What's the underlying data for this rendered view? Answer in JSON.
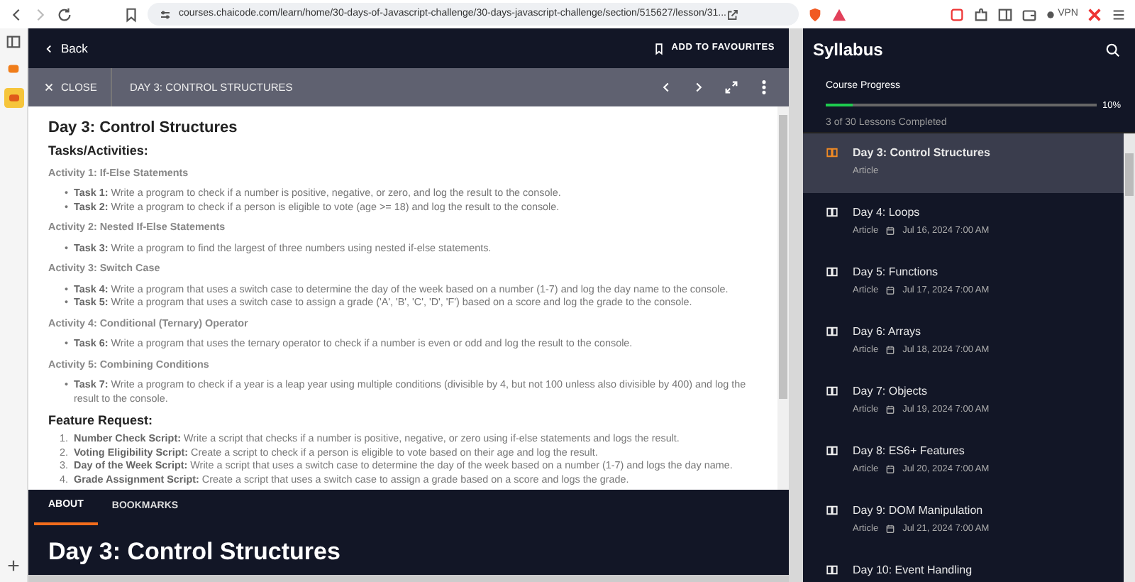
{
  "browser": {
    "url": "courses.chaicode.com/learn/home/30-days-of-Javascript-challenge/30-days-javascript-challenge/section/515627/lesson/31...",
    "vpn_label": "VPN"
  },
  "header": {
    "back_label": "Back",
    "favourite_label": "ADD TO FAVOURITES"
  },
  "lesson_bar": {
    "close_label": "CLOSE",
    "title": "DAY 3: CONTROL STRUCTURES"
  },
  "article": {
    "title": "Day 3: Control Structures",
    "tasks_heading": "Tasks/Activities:",
    "activities": [
      {
        "heading": "Activity 1: If-Else Statements",
        "marker": "•",
        "tasks": [
          "**Task 1:** Write a program to check if a number is positive, negative, or zero, and log the result to the console.",
          "**Task 2:** Write a program to check if a person is eligible to vote (age >= 18) and log the result to the console."
        ]
      },
      {
        "heading": "Activity 2: Nested If-Else Statements",
        "tasks": [
          "**Task 3:** Write a program to find the largest of three numbers using nested if-else statements."
        ]
      },
      {
        "heading": "Activity 3: Switch Case",
        "tasks": [
          "**Task 4:** Write a program that uses a switch case to determine the day of the week based on a number (1-7) and log the day name to the console.",
          "**Task 5:** Write a program that uses a switch case to assign a grade ('A', 'B', 'C', 'D', 'F') based on a score and log the grade to the console."
        ]
      },
      {
        "heading": "Activity 4: Conditional (Ternary) Operator",
        "tasks": [
          "**Task 6:** Write a program that uses the ternary operator to check if a number is even or odd and log the result to the console."
        ]
      },
      {
        "heading": "Activity 5: Combining Conditions",
        "tasks": [
          "**Task 7:** Write a program to check if a year is a leap year using multiple conditions (divisible by 4, but not 100 unless also divisible by 400) and log the result to the console."
        ]
      }
    ],
    "feature_heading": "Feature Request:",
    "feature_markers": [
      "1.",
      "2.",
      "3.",
      "4."
    ],
    "features": [
      "**Number Check Script:** Write a script that checks if a number is positive, negative, or zero using if-else statements and logs the result.",
      "**Voting Eligibility Script:** Create a script to check if a person is eligible to vote based on their age and log the result.",
      "**Day of the Week Script:** Write a script that uses a switch case to determine the day of the week based on a number (1-7) and logs the day name.",
      "**Grade Assignment Script:** Create a script that uses a switch case to assign a grade based on a score and logs the grade."
    ]
  },
  "tabs": [
    {
      "label": "ABOUT",
      "selected": true
    },
    {
      "label": "BOOKMARKS",
      "selected": false
    }
  ],
  "about_title": "Day 3: Control Structures",
  "syllabus": {
    "title": "Syllabus",
    "progress_label": "Course Progress",
    "level": 0.1,
    "percent": "10%",
    "completed": "3 of 30 Lessons Completed",
    "lessons": [
      {
        "title": "Day 3: Control Structures",
        "type": "Article",
        "selected": true
      },
      {
        "title": "Day 4: Loops",
        "type": "Article",
        "date": "Jul 16, 2024 7:00 AM",
        "selected": false
      },
      {
        "title": "Day 5: Functions",
        "type": "Article",
        "date": "Jul 17, 2024 7:00 AM",
        "selected": false
      },
      {
        "title": "Day 6: Arrays",
        "type": "Article",
        "date": "Jul 18, 2024 7:00 AM",
        "selected": false
      },
      {
        "title": "Day 7: Objects",
        "type": "Article",
        "date": "Jul 19, 2024 7:00 AM",
        "selected": false
      },
      {
        "title": "Day 8: ES6+ Features",
        "type": "Article",
        "date": "Jul 20, 2024 7:00 AM",
        "selected": false
      },
      {
        "title": "Day 9: DOM Manipulation",
        "type": "Article",
        "date": "Jul 21, 2024 7:00 AM",
        "selected": false
      },
      {
        "title": "Day 10: Event Handling",
        "selected": false
      }
    ]
  }
}
